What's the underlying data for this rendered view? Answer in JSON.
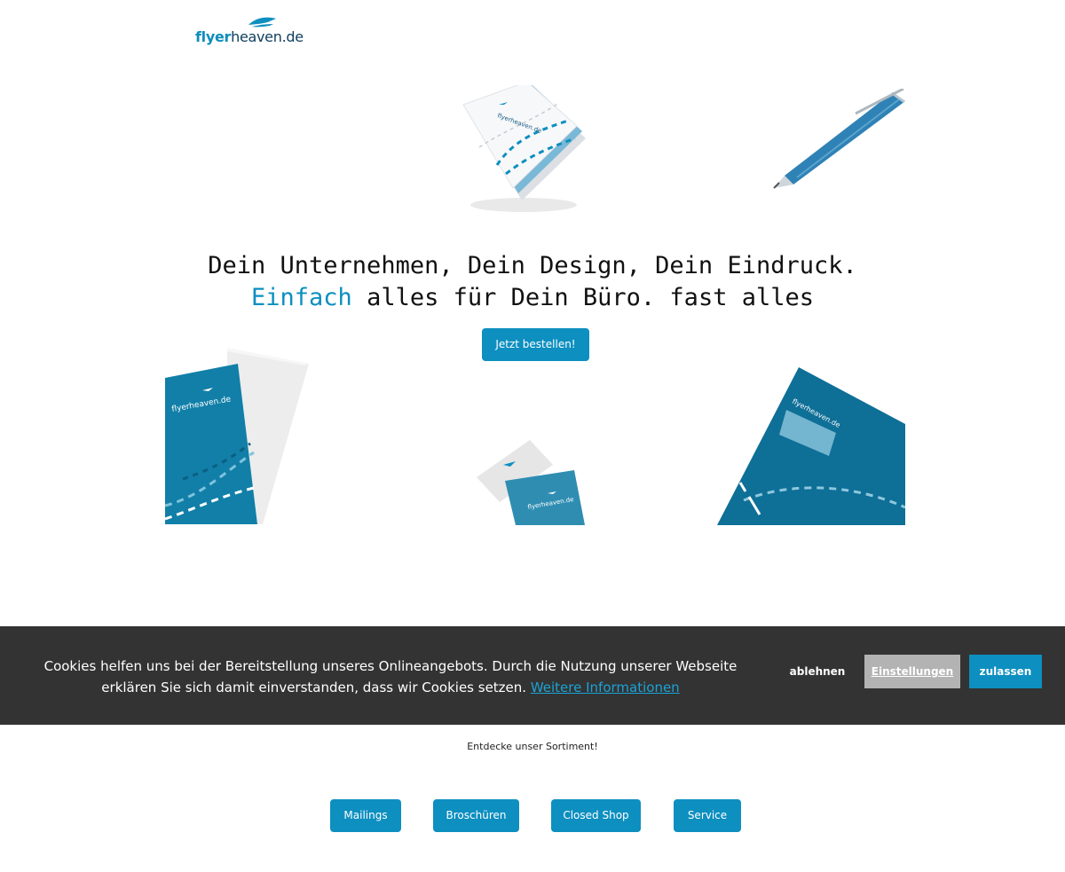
{
  "header": {
    "logo_part1": "flyer",
    "logo_part2": "heaven.de"
  },
  "hero": {
    "headline_line1": "Dein Unternehmen, Dein Design, Dein Eindruck.",
    "headline_accent": "Einfach",
    "headline_line2_rest": " alles für Dein Büro. fast alles",
    "cta_label": "Jetzt bestellen!"
  },
  "product_images": {
    "notepad_logo": "flyerheaven.de",
    "flyer_logo": "flyerheaven.de",
    "card_logo": "flyerheaven.de",
    "envelope_logo": "flyerheaven.de"
  },
  "cookie_banner": {
    "message": "Cookies helfen uns bei der Bereitstellung unseres Onlineangebots. Durch die Nutzung unserer Webseite erklären Sie sich damit einverstanden, dass wir Cookies setzen. ",
    "more_info_link": "Weitere Informationen",
    "decline_label": "ablehnen",
    "settings_label": "Einstellungen",
    "allow_label": "zulassen"
  },
  "sortiment": {
    "heading": "Entdecke unser Sortiment!",
    "buttons": [
      "Mailings",
      "Broschüren",
      "Closed Shop",
      "Service"
    ]
  },
  "colors": {
    "brand_blue": "#0d8fc0",
    "dark_blue": "#0e6f95",
    "cookie_bg": "#333333",
    "settings_grey": "#b3b3b3"
  },
  "icons": [
    "logo-bird-icon"
  ]
}
